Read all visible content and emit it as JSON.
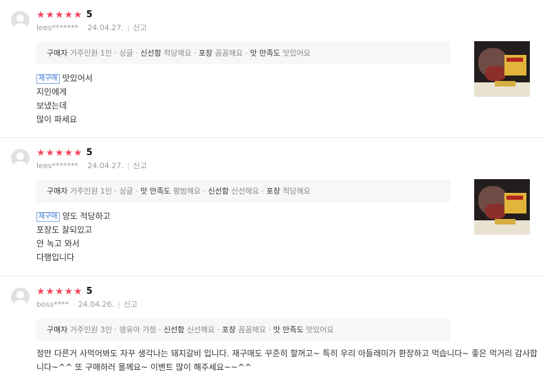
{
  "reviews": [
    {
      "score": "5",
      "user": "lees*******",
      "date": "24.04.27.",
      "report": "신고",
      "info": [
        {
          "label": "구매자",
          "value": "거주인원 1인 · 싱글"
        },
        {
          "label": "신선함",
          "value": "적당해요"
        },
        {
          "label": "포장",
          "value": "꼼꼼해요"
        },
        {
          "label": "맛 만족도",
          "value": "맛있어요"
        }
      ],
      "badge": "재구매",
      "lines": [
        "맛있어서",
        "지인에게",
        "보냈는데",
        "많이 파세요"
      ]
    },
    {
      "score": "5",
      "user": "lees*******",
      "date": "24.04.27.",
      "report": "신고",
      "info": [
        {
          "label": "구매자",
          "value": "거주인원 1인 · 싱글"
        },
        {
          "label": "맛 만족도",
          "value": "평범해요"
        },
        {
          "label": "신선함",
          "value": "신선해요"
        },
        {
          "label": "포장",
          "value": "적당해요"
        }
      ],
      "badge": "재구매",
      "lines": [
        "양도 적당하고",
        "포장도 잘되있고",
        "안 녹고 와서",
        "다행입니다"
      ]
    },
    {
      "score": "5",
      "user": "boss****",
      "date": "24.04.26.",
      "report": "신고",
      "info": [
        {
          "label": "구매자",
          "value": "거주인원 3인 · 영유아 가정"
        },
        {
          "label": "신선함",
          "value": "신선해요"
        },
        {
          "label": "포장",
          "value": "꼼꼼해요"
        },
        {
          "label": "맛 만족도",
          "value": "맛있어요"
        }
      ],
      "text_line1": "정만 다른거 사먹어봐도 자꾸 생각나는 돼지갈비 입니다. 재구매도 꾸준히 할꺼고~  특히 우리 아들래미가 환장하고 먹습니다~  좋은 먹거리 감사합",
      "text_line2": "니다~^^ 또 구매하러 올께요~ 이밴트 많이 해주세요~~^^"
    }
  ],
  "star_color": "#f0495d",
  "badge_color": "#3a75d8"
}
